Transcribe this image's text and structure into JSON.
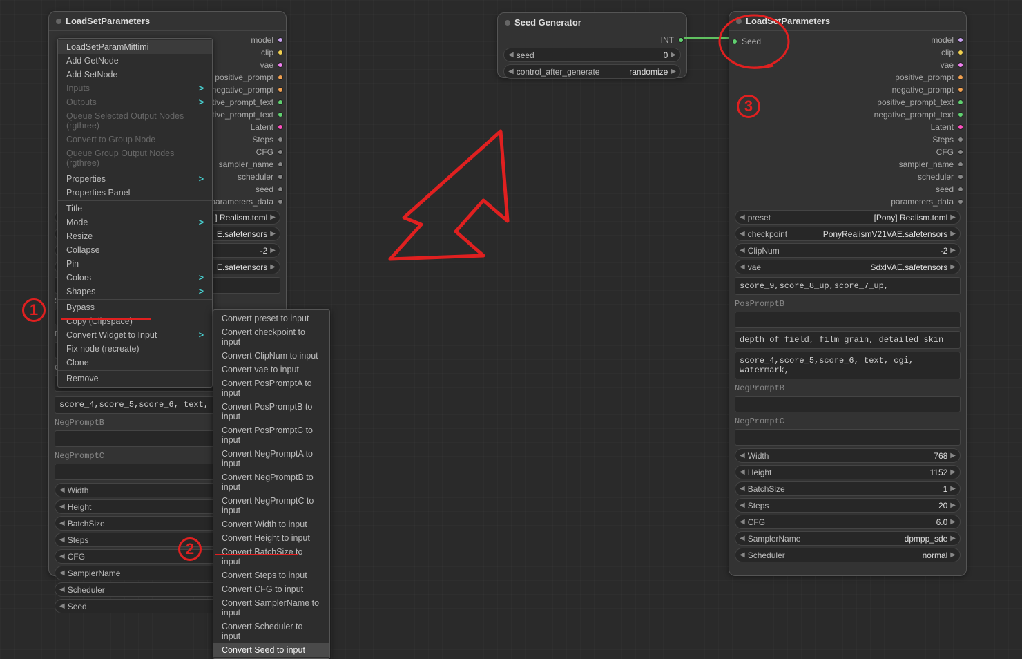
{
  "left_node": {
    "title": "LoadSetParameters",
    "outputs": [
      {
        "label": "model",
        "color": "lilac"
      },
      {
        "label": "clip",
        "color": "yellow"
      },
      {
        "label": "vae",
        "color": "pink"
      },
      {
        "label": "positive_prompt",
        "color": "orange"
      },
      {
        "label": "negative_prompt",
        "color": "orange"
      },
      {
        "label": "positive_prompt_text",
        "color": "green"
      },
      {
        "label": "negative_prompt_text",
        "color": "green"
      },
      {
        "label": "Latent",
        "color": "hotpink"
      },
      {
        "label": "Steps",
        "color": "gray"
      },
      {
        "label": "CFG",
        "color": "gray"
      },
      {
        "label": "sampler_name",
        "color": "gray"
      },
      {
        "label": "scheduler",
        "color": "gray"
      },
      {
        "label": "seed",
        "color": "gray"
      },
      {
        "label": "parameters_data",
        "color": "gray"
      }
    ],
    "widget_peek": [
      {
        "val": "] Realism.toml"
      },
      {
        "val": "E.safetensors"
      },
      {
        "val": "-2"
      },
      {
        "val": "E.safetensors"
      }
    ],
    "neg_line": "score_4,score_5,score_6, text, cgi,",
    "neg_b_label": "NegPromptB",
    "neg_c_label": "NegPromptC",
    "widgets_bottom": [
      {
        "label": "Width",
        "val": ""
      },
      {
        "label": "Height",
        "val": ""
      },
      {
        "label": "BatchSize",
        "val": ""
      },
      {
        "label": "Steps",
        "val": ""
      },
      {
        "label": "CFG",
        "val": ""
      },
      {
        "label": "SamplerName",
        "val": ""
      },
      {
        "label": "Scheduler",
        "val": ""
      },
      {
        "label": "Seed",
        "val": ""
      }
    ]
  },
  "ctx_main": {
    "items": [
      {
        "label": "LoadSetParamMittimi",
        "type": "input"
      },
      {
        "label": "Add GetNode"
      },
      {
        "label": "Add SetNode"
      },
      {
        "label": "Inputs",
        "sub": true,
        "disabled": true
      },
      {
        "label": "Outputs",
        "sub": true,
        "disabled": true
      },
      {
        "label": "Queue Selected Output Nodes (rgthree)",
        "disabled": true
      },
      {
        "label": "Convert to Group Node",
        "disabled": true
      },
      {
        "label": "Queue Group Output Nodes (rgthree)",
        "disabled": true
      },
      {
        "label": "Properties",
        "sub": true
      },
      {
        "label": "Properties Panel"
      },
      {
        "label": "Title"
      },
      {
        "label": "Mode",
        "sub": true
      },
      {
        "label": "Resize"
      },
      {
        "label": "Collapse"
      },
      {
        "label": "Pin"
      },
      {
        "label": "Colors",
        "sub": true
      },
      {
        "label": "Shapes",
        "sub": true
      },
      {
        "label": "Bypass"
      },
      {
        "label": "Copy (Clipspace)"
      },
      {
        "label": "Convert Widget to Input",
        "sub": true,
        "hl": true
      },
      {
        "label": "Fix node (recreate)"
      },
      {
        "label": "Clone"
      },
      {
        "label": "Remove"
      }
    ]
  },
  "ctx_sub": {
    "items": [
      "Convert preset to input",
      "Convert checkpoint to input",
      "Convert ClipNum to input",
      "Convert vae to input",
      "Convert PosPromptA to input",
      "Convert PosPromptB to input",
      "Convert PosPromptC to input",
      "Convert NegPromptA to input",
      "Convert NegPromptB to input",
      "Convert NegPromptC to input",
      "Convert Width to input",
      "Convert Height to input",
      "Convert BatchSize to input",
      "Convert Steps to input",
      "Convert CFG to input",
      "Convert SamplerName to input",
      "Convert Scheduler to input",
      "Convert Seed to input"
    ],
    "hl_index": 17
  },
  "seed_node": {
    "title": "Seed Generator",
    "out_label": "INT",
    "seed_label": "seed",
    "seed_val": "0",
    "cag_label": "control_after_generate",
    "cag_val": "randomize"
  },
  "right_node": {
    "title": "LoadSetParameters",
    "seed_input": "Seed",
    "outputs": [
      {
        "label": "model",
        "color": "lilac"
      },
      {
        "label": "clip",
        "color": "yellow"
      },
      {
        "label": "vae",
        "color": "pink"
      },
      {
        "label": "positive_prompt",
        "color": "orange"
      },
      {
        "label": "negative_prompt",
        "color": "orange"
      },
      {
        "label": "positive_prompt_text",
        "color": "green"
      },
      {
        "label": "negative_prompt_text",
        "color": "green"
      },
      {
        "label": "Latent",
        "color": "hotpink"
      },
      {
        "label": "Steps",
        "color": "gray"
      },
      {
        "label": "CFG",
        "color": "gray"
      },
      {
        "label": "sampler_name",
        "color": "gray"
      },
      {
        "label": "scheduler",
        "color": "gray"
      },
      {
        "label": "seed",
        "color": "gray"
      },
      {
        "label": "parameters_data",
        "color": "gray"
      }
    ],
    "widget_top": [
      {
        "label": "preset",
        "val": "[Pony] Realism.toml"
      },
      {
        "label": "checkpoint",
        "val": "PonyRealismV21VAE.safetensors"
      },
      {
        "label": "ClipNum",
        "val": "-2"
      },
      {
        "label": "vae",
        "val": "SdxlVAE.safetensors"
      }
    ],
    "pos_a": "score_9,score_8_up,score_7_up,",
    "pos_b_label": "PosPromptB",
    "pos_c": "depth of field, film grain, detailed skin",
    "neg_a": "score_4,score_5,score_6, text, cgi, watermark,",
    "neg_b_label": "NegPromptB",
    "neg_c_label": "NegPromptC",
    "widgets_bottom": [
      {
        "label": "Width",
        "val": "768"
      },
      {
        "label": "Height",
        "val": "1152"
      },
      {
        "label": "BatchSize",
        "val": "1"
      },
      {
        "label": "Steps",
        "val": "20"
      },
      {
        "label": "CFG",
        "val": "6.0"
      },
      {
        "label": "SamplerName",
        "val": "dpmpp_sde"
      },
      {
        "label": "Scheduler",
        "val": "normal"
      }
    ]
  },
  "annotations": {
    "one": "1",
    "two": "2",
    "three": "3"
  }
}
